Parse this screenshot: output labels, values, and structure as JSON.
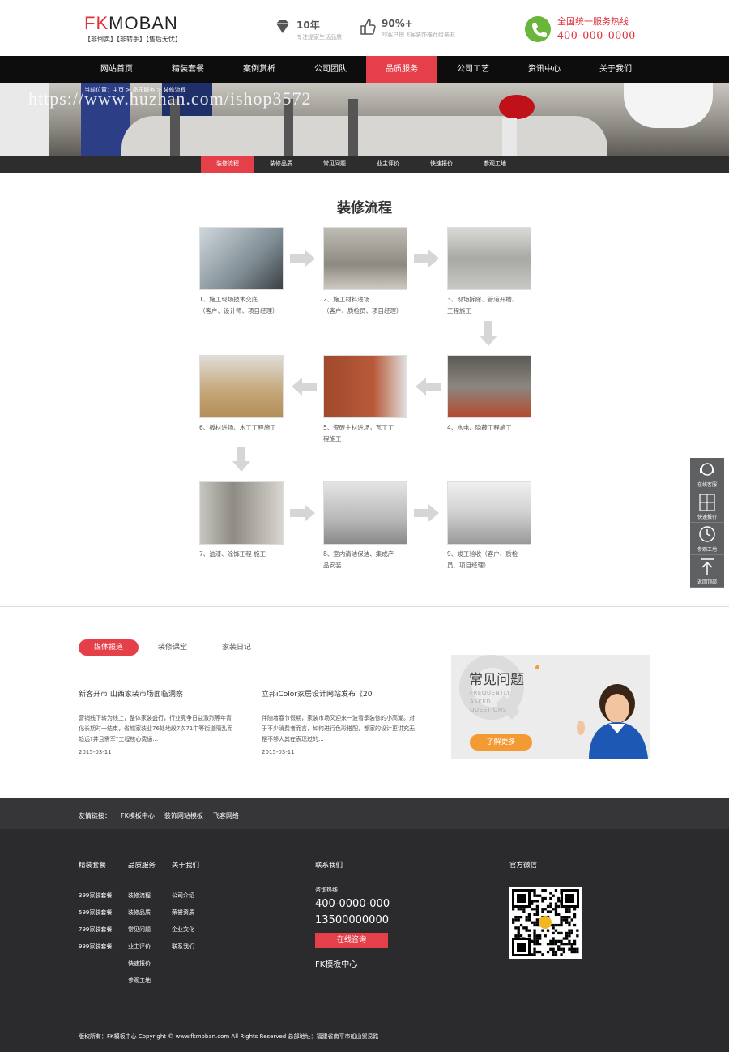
{
  "header": {
    "logo_prefix": "FK",
    "logo_rest": "MOBAN",
    "slogan": "【非倒卖】【非转手】【售后无忧】",
    "feature1": {
      "title": "10年",
      "sub": "专注提家生活品质"
    },
    "feature2": {
      "title": "90%+",
      "sub": "的客户把飞客装饰推荐给亲友"
    },
    "hotline_label": "全国统一服务热线",
    "hotline_number": "400-000-0000",
    "icons": {
      "feature1": "diamond-icon",
      "feature2": "thumbs-up-icon",
      "hotline": "phone-icon"
    },
    "accent_color": "#e5404a"
  },
  "nav": {
    "items": [
      "网站首页",
      "精装套餐",
      "案例赏析",
      "公司团队",
      "品质服务",
      "公司工艺",
      "资讯中心",
      "关于我们"
    ],
    "active_index": 4
  },
  "banner": {
    "breadcrumb": "当前位置：主页 > 品质服务 > 装修流程",
    "watermark": "https://www.huzhan.com/ishop3572"
  },
  "subnav": {
    "items": [
      "装修流程",
      "装修品质",
      "常见问题",
      "业主评价",
      "快速报价",
      "参观工地"
    ],
    "active_index": 0
  },
  "process": {
    "title": "装修流程",
    "steps": [
      {
        "line1": "1、施工现场技术交底",
        "line2": "（客户、设计师、项目经理）"
      },
      {
        "line1": "2、施工材料进场",
        "line2": "（客户、质检员、项目经理）"
      },
      {
        "line1": "3、现场拆除、管道开槽、",
        "line2": "工程施工"
      },
      {
        "line1": "4、水电、隐蔽工程施工",
        "line2": ""
      },
      {
        "line1": "5、瓷砖主材进场，瓦工工",
        "line2": "程施工"
      },
      {
        "line1": "6、板材进场、木工工程施工",
        "line2": ""
      },
      {
        "line1": "7、油漆、涂饰工程 施工",
        "line2": ""
      },
      {
        "line1": "8、室内清洁保洁、集成产",
        "line2": "品安装"
      },
      {
        "line1": "9、竣工验收（客户、质检",
        "line2": "员、项目经理）"
      }
    ]
  },
  "news": {
    "tabs": [
      "媒体报道",
      "装修课堂",
      "家装日记"
    ],
    "active_tab": 0,
    "items": [
      {
        "title": "新客开市 山西家装市场面临洞察",
        "desc": "营销线下转为线上，整体家装盛行，行业竞争日益激烈等年青化长期时一结束，省城家装业76处地段7次71中等街道隔乱而趋远?并且需军?工程核心费通...",
        "date": "2015-03-11"
      },
      {
        "title": "立邦iColor家居设计网站发布《20",
        "desc": "伴随着春节假期，家装市场又迎来一波看季装修的小高潮。对于不少消费者而言，如何进行色彩搭配，都家的设计更讲究无摆不够大其在表现过的...",
        "date": "2015-03-11"
      }
    ],
    "faq": {
      "title": "常见问题",
      "en_lines": [
        "FREQUENTLY",
        "ASKED",
        "QUESTIONS"
      ],
      "button": "了解更多"
    }
  },
  "footer": {
    "links_label": "友情链接：",
    "links": [
      "FK模板中心",
      "装饰网站模板",
      "飞客网络"
    ],
    "columns": [
      {
        "heading": "精装套餐",
        "items": [
          "399家装套餐",
          "599家装套餐",
          "799家装套餐",
          "999家装套餐"
        ]
      },
      {
        "heading": "品质服务",
        "items": [
          "装修流程",
          "装修品质",
          "常见问题",
          "业主评价",
          "快速报价",
          "参观工地"
        ]
      },
      {
        "heading": "关于我们",
        "items": [
          "公司介绍",
          "荣誉资质",
          "企业文化",
          "联系我们"
        ]
      }
    ],
    "contact": {
      "heading": "联系我们",
      "label": "咨询热线",
      "phone1": "400-0000-000",
      "phone2": "13500000000",
      "button": "在线咨询",
      "name": "FK模板中心"
    },
    "wechat_heading": "官方微信",
    "copyright": "版权所有：FK模板中心 Copyright © www.fkmoban.com All Rights Reserved 总部地址：福建省南平市船山贸易路"
  },
  "sidebar": {
    "items": [
      {
        "label": "在线客服",
        "icon": "headset-icon"
      },
      {
        "label": "快速报价",
        "icon": "calculator-icon"
      },
      {
        "label": "参观工地",
        "icon": "clock-icon"
      },
      {
        "label": "返回顶部",
        "icon": "arrow-up-icon"
      }
    ]
  }
}
